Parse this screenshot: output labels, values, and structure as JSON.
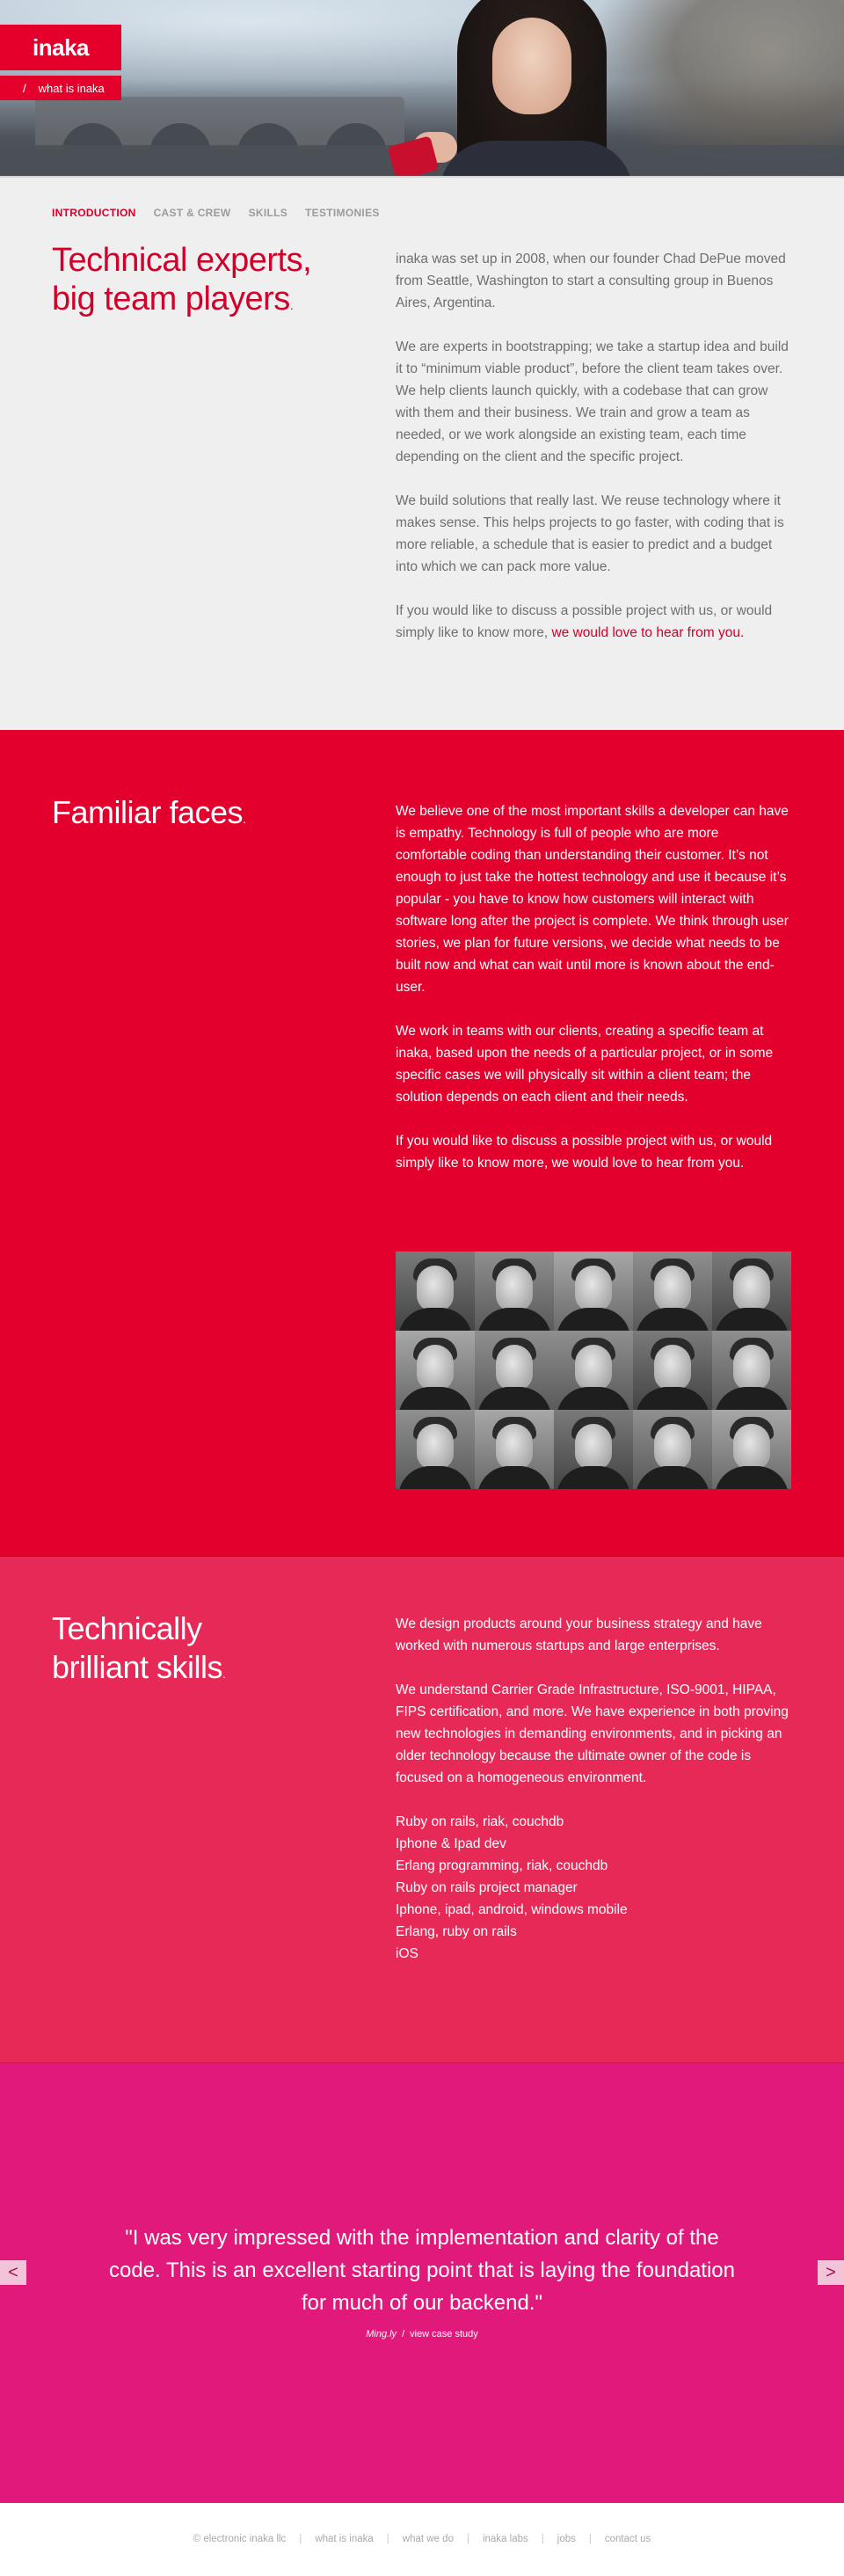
{
  "brand": {
    "logo": "inaka"
  },
  "breadcrumb": {
    "separator": "/",
    "label": "what is inaka"
  },
  "subnav": {
    "items": [
      {
        "label": "INTRODUCTION",
        "active": true
      },
      {
        "label": "CAST & CREW",
        "active": false
      },
      {
        "label": "SKILLS",
        "active": false
      },
      {
        "label": "TESTIMONIES",
        "active": false
      }
    ]
  },
  "intro": {
    "title_line1": "Technical experts,",
    "title_line2": "big team players",
    "title_dot": ".",
    "p1": "inaka was set up in 2008, when our founder Chad DePue moved from Seattle, Washington to start a consulting group in Buenos Aires, Argentina.",
    "p2": "We are experts in bootstrapping; we take a startup idea and build it to “minimum viable product”, before the client team takes over. We help clients launch quickly, with a codebase that can grow with them and their business. We train and grow a team as needed, or we work alongside an existing team, each time depending on the client and the specific project.",
    "p3": "We build solutions that really last. We reuse technology where it makes sense. This helps projects to go faster, with coding that is more reliable, a schedule that is easier to predict and a budget into which we can pack more value.",
    "p4_text": "If you would like to discuss a possible project with us, or would simply like to know more, ",
    "p4_link": "we would love to hear from you."
  },
  "faces": {
    "title": "Familiar faces",
    "title_dot": ".",
    "p1": "We believe one of the most important skills a developer can have is empathy. Technology is full of people who are more comfortable coding than understanding their customer. It’s not enough to just take the hottest technology and use it because it’s popular - you have to know how customers will interact with software long after the project is complete. We think through user stories, we plan for future versions, we decide what needs to be built now and what can wait until more is known about the end-user.",
    "p2": "We work in teams with our clients, creating a specific team at inaka, based upon the needs of a particular project, or in some specific cases we will physically sit within a client team; the solution depends on each client and their needs.",
    "p3": "If you would like to discuss a possible project with us, or would simply like to know more, we would love to hear from you."
  },
  "skills": {
    "title_line1": "Technically",
    "title_line2": "brilliant skills",
    "title_dot": ".",
    "p1": "We design products around your business strategy and have worked with numerous startups and large enterprises.",
    "p2": "We understand Carrier Grade Infrastructure, ISO-9001, HIPAA, FIPS certification, and more. We have experience in both proving new technologies in demanding environments, and in picking an older technology because the ultimate owner of the code is focused on a homogeneous environment.",
    "list": [
      "Ruby on rails, riak, couchdb",
      "Iphone & Ipad dev",
      "Erlang programming, riak, couchdb",
      "Ruby on rails project manager",
      "Iphone, ipad, android, windows mobile",
      "Erlang, ruby on rails",
      "iOS"
    ]
  },
  "testimonial": {
    "quote": "\"I was very impressed with the implementation and clarity of the code. This is an excellent starting point that is laying the foundation for much of our backend.\"",
    "client": "Ming.ly",
    "separator": "/",
    "link": "view case study",
    "prev_icon": "<",
    "next_icon": ">"
  },
  "footer": {
    "items": [
      "© electronic inaka llc",
      "what is inaka",
      "what we do",
      "inaka labs",
      "jobs",
      "contact us"
    ],
    "divider": "|"
  },
  "colors": {
    "brand_red": "#e4002b",
    "skills_pink": "#e62957",
    "testimonial_magenta": "#e0197a",
    "intro_bg": "#efefef"
  }
}
